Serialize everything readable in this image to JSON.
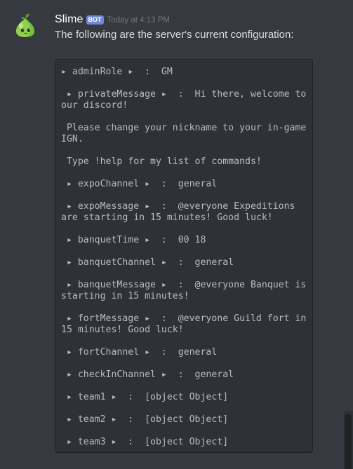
{
  "message": {
    "author": "Slime",
    "bot_tag": "BOT",
    "timestamp": "Today at 4:13 PM",
    "intro": "The following are the server's current configuration:",
    "avatar_icon": "slime-avatar-icon",
    "config_lines": [
      "▸ adminRole ▸  :  GM",
      " ▸ privateMessage ▸  :  Hi there, welcome to",
      "our discord!",
      " Please change your nickname to your in-game",
      "IGN.",
      " Type !help for my list of commands!",
      " ▸ expoChannel ▸  :  general",
      " ▸ expoMessage ▸  :  @everyone Expeditions",
      "are starting in 15 minutes! Good luck!",
      " ▸ banquetTime ▸  :  00 18",
      " ▸ banquetChannel ▸  :  general",
      " ▸ banquetMessage ▸  :  @everyone Banquet is",
      "starting in 15 minutes!",
      " ▸ fortMessage ▸  :  @everyone Guild fort in",
      "15 minutes! Good luck!",
      " ▸ fortChannel ▸  :  general",
      " ▸ checkInChannel ▸  :  general",
      " ▸ team1 ▸  :  [object Object]",
      " ▸ team2 ▸  :  [object Object]",
      " ▸ team3 ▸  :  [object Object]"
    ]
  },
  "colors": {
    "background": "#36393f",
    "codeblock_bg": "#2f3136",
    "bot_tag": "#7289da",
    "text": "#dcddde",
    "muted": "#72767d",
    "avatar_green": "#8fd14f"
  }
}
